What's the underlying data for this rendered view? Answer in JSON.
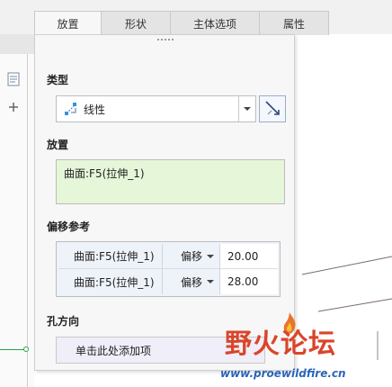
{
  "tabs": [
    {
      "label": "放置",
      "active": true
    },
    {
      "label": "形状",
      "active": false
    },
    {
      "label": "主体选项",
      "active": false
    },
    {
      "label": "属性",
      "active": false
    }
  ],
  "panel": {
    "type_section": {
      "label": "类型",
      "selected": "线性"
    },
    "placement_section": {
      "label": "放置",
      "value": "曲面:F5(拉伸_1)"
    },
    "offset_section": {
      "label": "偏移参考",
      "rows": [
        {
          "reference": "曲面:F5(拉伸_1)",
          "type": "偏移",
          "value": "20.00"
        },
        {
          "reference": "曲面:F5(拉伸_1)",
          "type": "偏移",
          "value": "28.00"
        }
      ]
    },
    "direction_section": {
      "label": "孔方向",
      "placeholder": "单击此处添加项"
    }
  },
  "watermark": {
    "title": "野火论坛",
    "url": "www.proewildfire.cn"
  },
  "colors": {
    "placement_bg": "#e6f6d9",
    "offset_bg": "#eef2f9",
    "watermark_red": "#d9452a",
    "watermark_blue": "#2a64b8"
  }
}
